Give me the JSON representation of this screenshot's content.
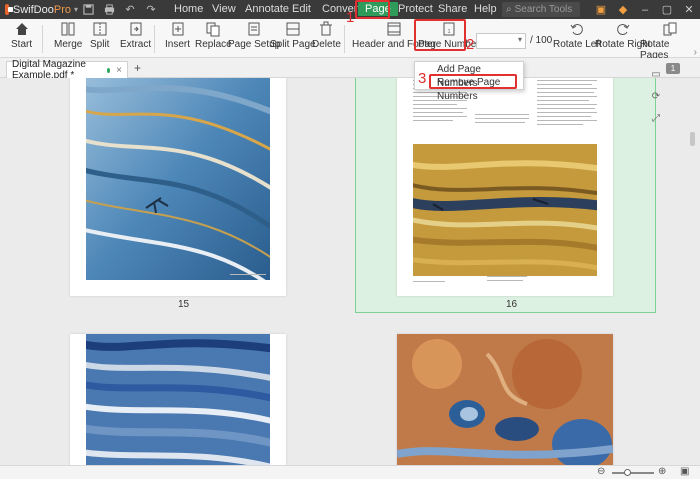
{
  "app": {
    "name": "SwifDoo",
    "edition": "Pro",
    "menu": [
      "Home",
      "View",
      "Annotate",
      "Edit",
      "Convert",
      "Page",
      "Protect",
      "Share",
      "Help"
    ],
    "active_menu": "Page",
    "search_placeholder": "Search Tools"
  },
  "toolbar": {
    "start": "Start",
    "merge": "Merge",
    "split": "Split",
    "extract": "Extract",
    "insert": "Insert",
    "replace": "Replace",
    "page_setup": "Page Setup",
    "split_page": "Split Page",
    "delete": "Delete",
    "header_footer": "Header and Footer",
    "page_number": "Page Number",
    "page_input_value": "",
    "page_total": "/ 100",
    "rotate_left": "Rotate Left",
    "rotate_right": "Rotate Right",
    "rotate_pages": "Rotate Pages"
  },
  "tabs": {
    "document": "Digital Magazine Example.pdf *",
    "page_counter": "1"
  },
  "dropdown": {
    "items": [
      "Add Page Numbers",
      "Remove Page Numbers"
    ]
  },
  "pages": {
    "left_top": "15",
    "right_top": "16"
  },
  "annotations": [
    "1",
    "2",
    "3"
  ],
  "colors": {
    "accent_green": "#2e9b5a",
    "annotation_red": "#e03030",
    "selection": "#dcf1e1"
  }
}
